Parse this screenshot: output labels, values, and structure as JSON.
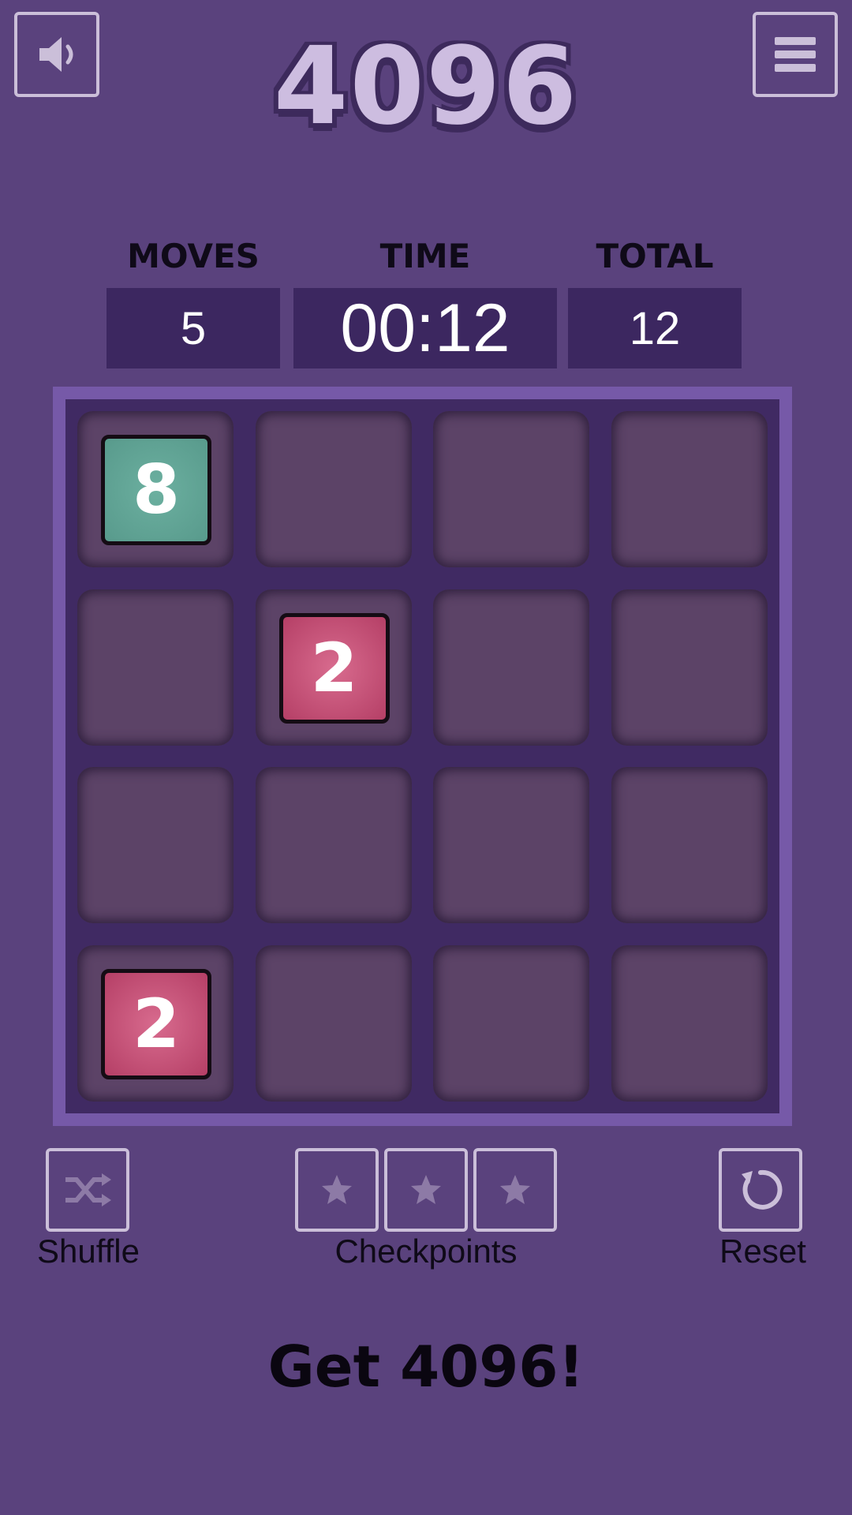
{
  "header": {
    "title": "4096",
    "sound_icon": "speaker-icon",
    "menu_icon": "hamburger-menu-icon"
  },
  "stats": {
    "moves_label": "MOVES",
    "moves_value": "5",
    "time_label": "TIME",
    "time_value": "00:12",
    "total_label": "TOTAL",
    "total_value": "12"
  },
  "board": {
    "rows": 4,
    "cols": 4,
    "cells": [
      [
        "8",
        "",
        "",
        ""
      ],
      [
        "",
        "2",
        "",
        ""
      ],
      [
        "",
        "",
        "",
        ""
      ],
      [
        "2",
        "",
        "",
        ""
      ]
    ]
  },
  "controls": {
    "shuffle_label": "Shuffle",
    "checkpoints_label": "Checkpoints",
    "reset_label": "Reset",
    "checkpoint_count": 3
  },
  "goal": "Get 4096!",
  "colors": {
    "background": "#5a427d",
    "board_frame": "#7659a8",
    "board_fill": "#402a63",
    "cell": "#5c4367",
    "tile_8": "#5fa394",
    "tile_2": "#c64f76",
    "stat_box": "#3c2760"
  }
}
